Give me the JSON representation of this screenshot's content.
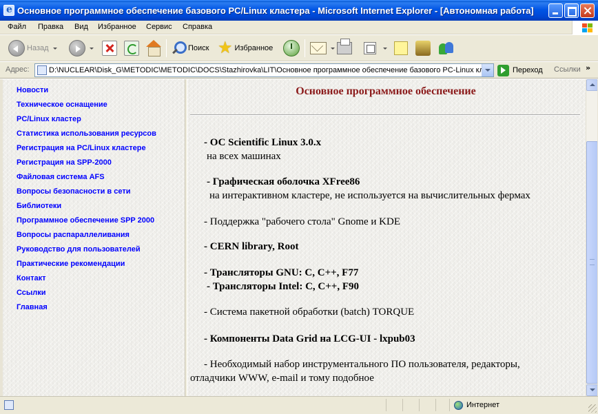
{
  "window": {
    "title": "Основное программное обеспечение базового PC/Linux кластера - Microsoft Internet Explorer - [Автономная работа]"
  },
  "menu": [
    "Файл",
    "Правка",
    "Вид",
    "Избранное",
    "Сервис",
    "Справка"
  ],
  "toolbar": {
    "back_label": "Назад",
    "search_label": "Поиск",
    "favorites_label": "Избранное"
  },
  "address": {
    "label": "Адрес:",
    "url": "D:\\NUCLEAR\\Disk_G\\METODIC\\METODIC\\DOCS\\Stazhirovka\\LIT\\Основное программное обеспечение базового PC-Linux кластера.htm",
    "go_label": "Переход",
    "links_label": "Ссылки",
    "links_chevron": "»"
  },
  "nav": [
    "Новости",
    "Техническое оснащение",
    "PC/Linux кластер",
    "Статистика использования ресурсов",
    "Регистрация на PC/Linux кластере",
    "Регистрация на SPP-2000",
    "Файловая система AFS",
    "Вопросы безопасности в сети",
    "Библиотеки",
    "Программное обеспечение SPP 2000",
    "Вопросы распараллеливания",
    "Руководство для пользователей",
    "Практические рекомендации",
    "Контакт",
    "Ссылки",
    "Главная"
  ],
  "page": {
    "title": "Основное программное обеспечение",
    "lines": [
      "- ОС Scientific Linux 3.0.x",
      "на всех машинах",
      "- Графическая оболочка XFree86",
      "на интерактивном кластере, не используется на вычислительных фермах",
      "- Поддержка \"рабочего стола\" Gnome и KDE",
      "- CERN library, Root",
      "- Трансляторы GNU: C, C++, F77",
      "- Трансляторы Intel: C, C++, F90",
      "- Система пакетной обработки (batch) TORQUE",
      "- Компоненты Data Grid на LCG-UI - lxpub03",
      "- Необходимый набор инструментального ПО пользователя, редакторы,",
      "отладчики WWW, e-mail и тому подобное"
    ]
  },
  "status": {
    "zone_label": "Интернет"
  },
  "colors": {
    "title_bar": "#0055e5",
    "link": "#0000ff",
    "page_title": "#8b1a1a",
    "chrome": "#ece9d8"
  }
}
